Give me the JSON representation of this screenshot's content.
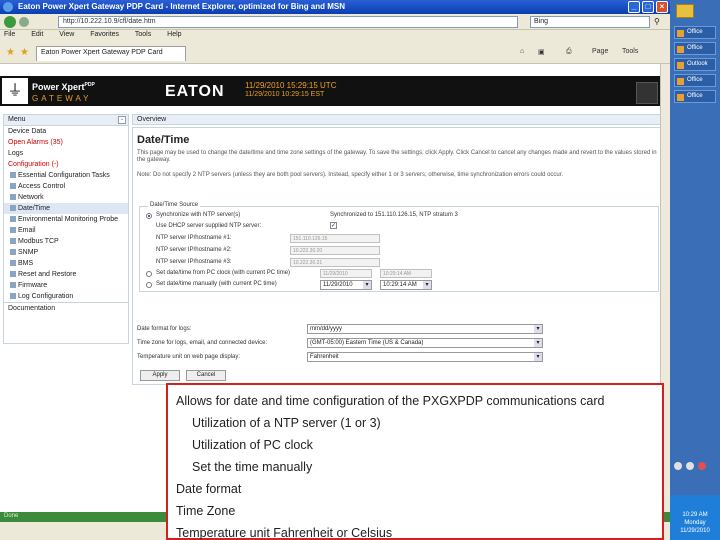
{
  "window": {
    "title": "Eaton Power Xpert Gateway PDP Card - Internet Explorer, optimized for Bing and MSN",
    "address": "http://10.222.10.9/cfl/date.htm",
    "search_placeholder": "Bing",
    "tab_label": "Eaton Power Xpert Gateway PDP Card",
    "page_menu": "Page",
    "tools_menu": "Tools"
  },
  "menubar": [
    "File",
    "Edit",
    "View",
    "Favorites",
    "Tools",
    "Help"
  ],
  "banner": {
    "brand": "Power Xpert",
    "brand_suffix": "PDP",
    "brand_sub": "GATEWAY",
    "company": "EATON",
    "datetime_primary": "11/29/2010 15:29:15 UTC",
    "datetime_local": "11/29/2010 10:29:15 EST"
  },
  "menu": {
    "header": "Menu",
    "items": [
      {
        "label": "Device Data",
        "type": "top"
      },
      {
        "label": "Open Alarms (35)",
        "type": "alarm"
      },
      {
        "label": "Logs",
        "type": "top"
      },
      {
        "label": "Configuration (-)",
        "type": "alarm"
      },
      {
        "label": "Essential Configuration Tasks",
        "type": "sub"
      },
      {
        "label": "Access Control",
        "type": "sub"
      },
      {
        "label": "Network",
        "type": "sub"
      },
      {
        "label": "Date/Time",
        "type": "sub"
      },
      {
        "label": "Environmental Monitoring Probe",
        "type": "sub"
      },
      {
        "label": "Email",
        "type": "sub"
      },
      {
        "label": "Modbus TCP",
        "type": "sub"
      },
      {
        "label": "SNMP",
        "type": "sub"
      },
      {
        "label": "BMS",
        "type": "sub"
      },
      {
        "label": "Reset and Restore",
        "type": "sub"
      },
      {
        "label": "Firmware",
        "type": "sub"
      },
      {
        "label": "Log Configuration",
        "type": "sub"
      },
      {
        "label": "Documentation",
        "type": "top"
      }
    ]
  },
  "content": {
    "overview": "Overview",
    "title": "Date/Time",
    "intro": "This page may be used to change the date/time and time zone settings of the gateway. To save the settings, click Apply. Click Cancel to cancel any changes made and revert to the values stored in the gateway.",
    "note": "Note: Do not specify 2 NTP servers (unless they are both pool servers). Instead, specify either 1 or 3 servers; otherwise, time synchronization errors could occur.",
    "fieldset_legend": "Date/Time Source",
    "opt_ntp": "Synchronize with NTP server(s)",
    "sync_status": "Synchronized to 151.110.126.15, NTP stratum 3",
    "dhcp_label": "Use DHCP server supplied NTP server:",
    "ntp1_label": "NTP server IP/hostname #1:",
    "ntp1_value": "151.110.126.15",
    "ntp2_label": "NTP server IP/hostname #2:",
    "ntp2_value": "10.222.30.20",
    "ntp3_label": "NTP server IP/hostname #3:",
    "ntp3_value": "10.222.30.21",
    "opt_pc": "Set date/time from PC clock (with current PC time)",
    "pc_date": "11/29/2010",
    "pc_time": "10:29:14 AM",
    "opt_manual": "Set date/time manually (with current PC time)",
    "manual_date": "11/29/2010",
    "manual_time": "10:29:14 AM",
    "date_format_label": "Date format for logs:",
    "date_format_value": "mm/dd/yyyy",
    "timezone_label": "Time zone for logs, email, and connected device:",
    "timezone_value": "(GMT-05:00) Eastern Time (US & Canada)",
    "temp_label": "Temperature unit on web page display:",
    "temp_value": "Fahrenheit",
    "apply": "Apply",
    "cancel": "Cancel"
  },
  "status": "Done",
  "callout": {
    "lines": [
      {
        "text": "Allows for date and time configuration of the PXGXPDP communications card",
        "indent": false
      },
      {
        "text": "Utilization of a NTP server (1 or 3)",
        "indent": true
      },
      {
        "text": "Utilization of PC clock",
        "indent": true
      },
      {
        "text": "Set the time manually",
        "indent": true
      },
      {
        "text": "Date format",
        "indent": false
      },
      {
        "text": "Time Zone",
        "indent": false
      },
      {
        "text": "Temperature unit Fahrenheit or Celsius",
        "indent": false
      }
    ]
  },
  "desktop": {
    "items": [
      "Office",
      "Office",
      "Outlook",
      "Office",
      "Office"
    ],
    "clock": "10:29 AM",
    "clock_day": "Monday",
    "clock_date": "11/29/2010"
  }
}
